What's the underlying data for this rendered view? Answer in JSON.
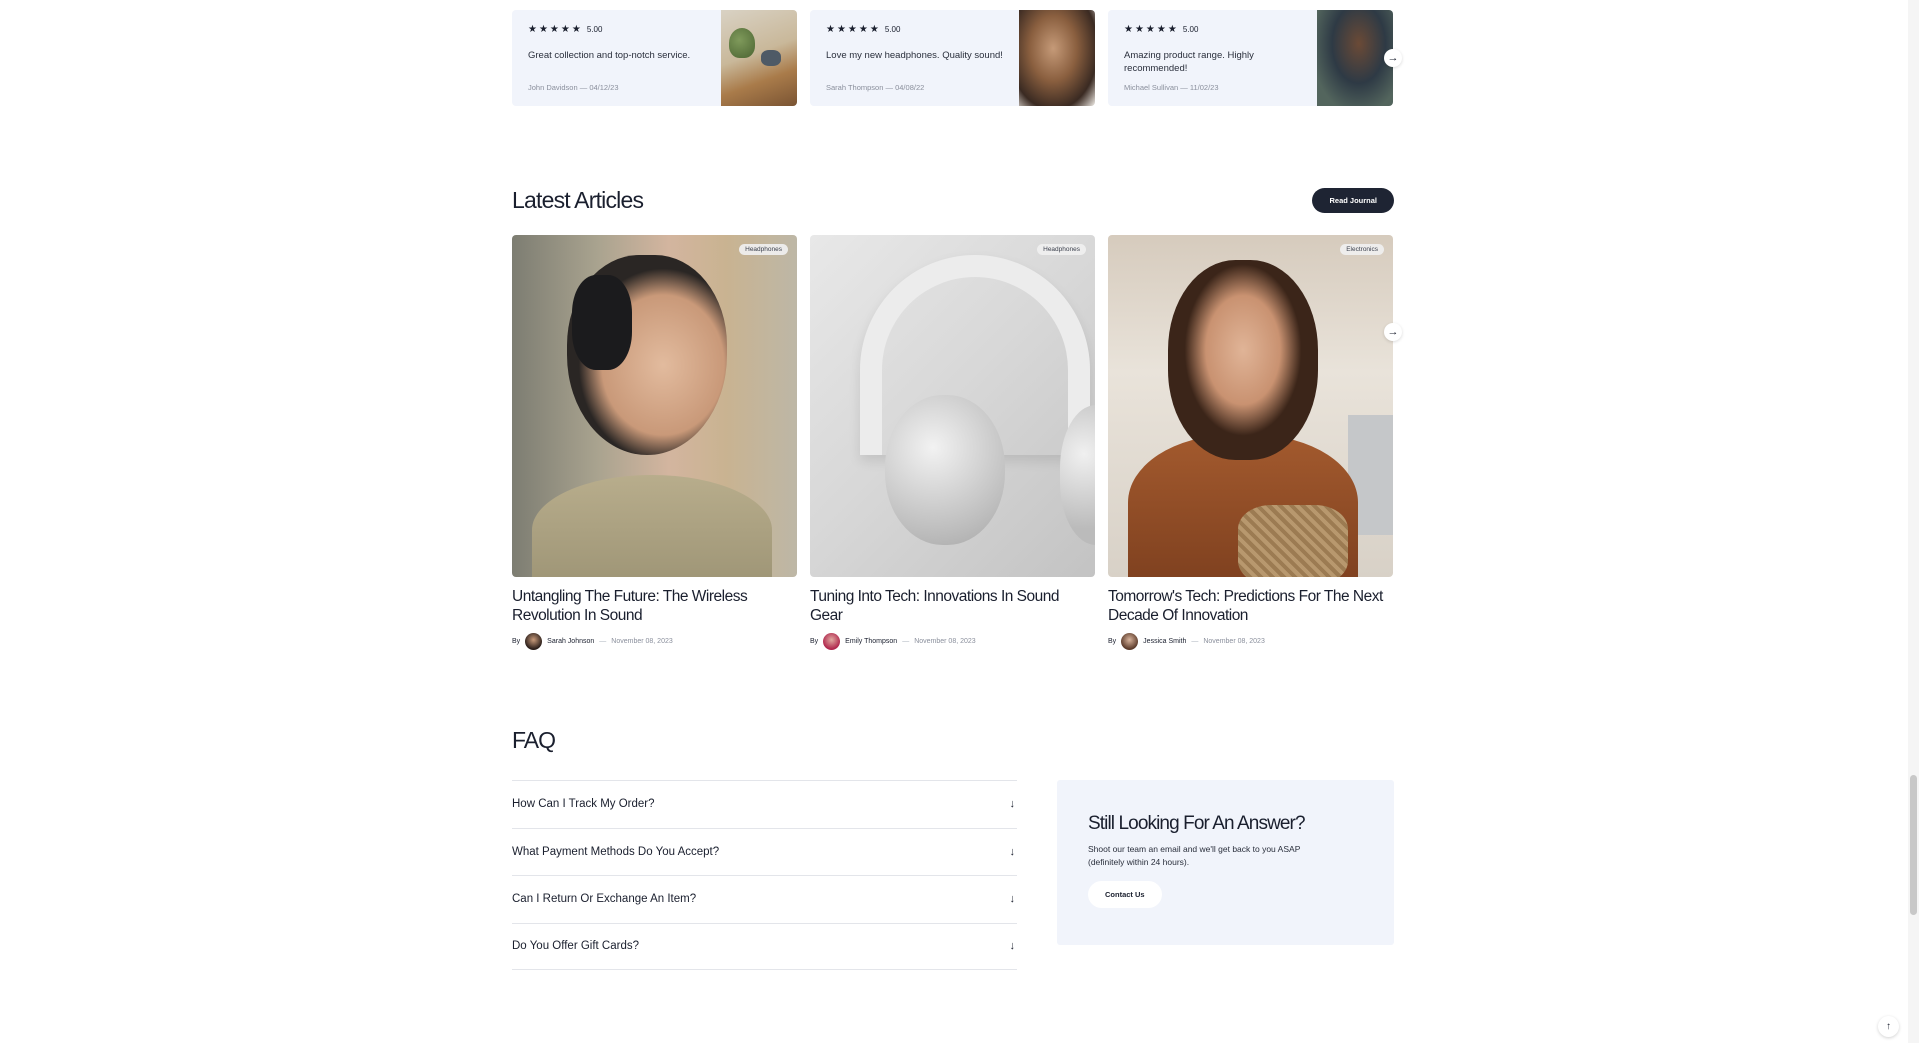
{
  "reviews": [
    {
      "stars": "★★★★★",
      "score": "5.00",
      "text": "Great collection and top-notch service.",
      "author": "John Davidson",
      "sep": "—",
      "date": "04/12/23"
    },
    {
      "stars": "★★★★★",
      "score": "5.00",
      "text": "Love my new headphones. Quality sound!",
      "author": "Sarah Thompson",
      "sep": "—",
      "date": "04/08/22"
    },
    {
      "stars": "★★★★★",
      "score": "5.00",
      "text": "Amazing product range. Highly recommended!",
      "author": "Michael Sullivan",
      "sep": "—",
      "date": "11/02/23"
    }
  ],
  "reviews_next_icon": "arrow-right-icon",
  "articles_section": {
    "title": "Latest Articles",
    "button_label": "Read Journal"
  },
  "articles": [
    {
      "tag": "Headphones",
      "title": "Untangling The Future: The Wireless Revolution In Sound",
      "by": "By",
      "author": "Sarah Johnson",
      "sep": "—",
      "date": "November 08, 2023"
    },
    {
      "tag": "Headphones",
      "title": "Tuning Into Tech: Innovations In Sound Gear",
      "by": "By",
      "author": "Emily Thompson",
      "sep": "—",
      "date": "November 08, 2023"
    },
    {
      "tag": "Electronics",
      "title": "Tomorrow's Tech: Predictions For The Next Decade Of Innovation",
      "by": "By",
      "author": "Jessica Smith",
      "sep": "—",
      "date": "November 08, 2023"
    }
  ],
  "faq": {
    "title": "FAQ",
    "items": [
      {
        "question": "How Can I Track My Order?"
      },
      {
        "question": "What Payment Methods Do You Accept?"
      },
      {
        "question": "Can I Return Or Exchange An Item?"
      },
      {
        "question": "Do You Offer Gift Cards?"
      }
    ],
    "arrow": "↓"
  },
  "answer_box": {
    "title": "Still Looking For An Answer?",
    "text": "Shoot our team an email and we'll get back to you ASAP (definitely within 24 hours).",
    "button_label": "Contact Us"
  },
  "arrows": {
    "next": "→",
    "up": "↑"
  }
}
